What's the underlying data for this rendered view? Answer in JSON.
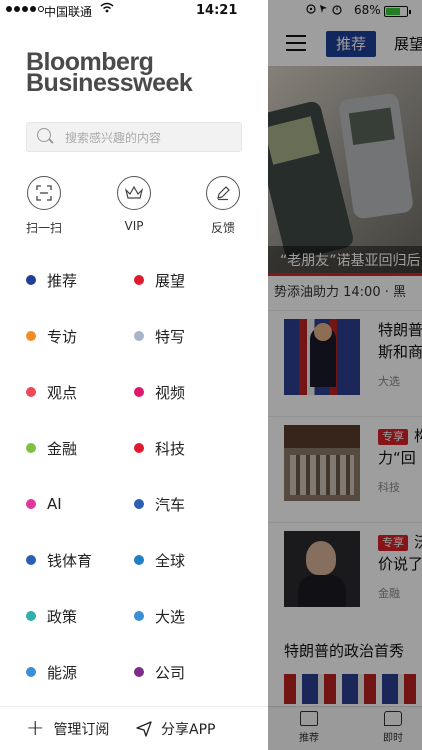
{
  "status_left": {
    "carrier": "中国联通",
    "time": "14:21"
  },
  "status_right": {
    "battery_pct": "68%"
  },
  "drawer": {
    "logo_line1": "Bloomberg",
    "logo_line2": "Businessweek",
    "search_placeholder": "搜索感兴趣的内容",
    "quick_actions": [
      {
        "label": "扫一扫",
        "icon": "scan-icon"
      },
      {
        "label": "VIP",
        "icon": "crown-icon"
      },
      {
        "label": "反馈",
        "icon": "pencil-icon"
      }
    ],
    "categories": [
      {
        "label": "推荐",
        "color": "#1f3f99"
      },
      {
        "label": "展望",
        "color": "#e0182d"
      },
      {
        "label": "专访",
        "color": "#f28c28"
      },
      {
        "label": "特写",
        "color": "#a8b4c8"
      },
      {
        "label": "观点",
        "color": "#ec4a5b"
      },
      {
        "label": "视频",
        "color": "#e0186d"
      },
      {
        "label": "金融",
        "color": "#7cc242"
      },
      {
        "label": "科技",
        "color": "#e0182d"
      },
      {
        "label": "AI",
        "color": "#e0399a"
      },
      {
        "label": "汽车",
        "color": "#2b5fb0"
      },
      {
        "label": "钱体育",
        "color": "#2b5fb0"
      },
      {
        "label": "全球",
        "color": "#1f7fc2"
      },
      {
        "label": "政策",
        "color": "#2fb1aa"
      },
      {
        "label": "大选",
        "color": "#3b8fd4"
      },
      {
        "label": "能源",
        "color": "#3b8fd4"
      },
      {
        "label": "公司",
        "color": "#7b2d87"
      }
    ],
    "footer": {
      "manage_label": "管理订阅",
      "share_label": "分享APP"
    }
  },
  "main": {
    "nav": {
      "active_tab": "推荐",
      "next_tab": "展望"
    },
    "hero_caption": "“老朋友”诺基亚回归后",
    "ticker": "势添油助力 14:00 · 黑",
    "articles": [
      {
        "title_line1": "特朗普",
        "title_line2": "斯和商",
        "badge": "",
        "category": "大选"
      },
      {
        "title_line1": "构",
        "title_line2": "力“回",
        "badge": "专享",
        "category": "科技"
      },
      {
        "title_line1": "沃",
        "title_line2": "价说了",
        "badge": "专享",
        "category": "金融"
      }
    ],
    "section_title": "特朗普的政治首秀",
    "tabbar": [
      {
        "label": "推荐",
        "icon": "news-icon"
      },
      {
        "label": "即时",
        "icon": "message-icon"
      }
    ]
  }
}
